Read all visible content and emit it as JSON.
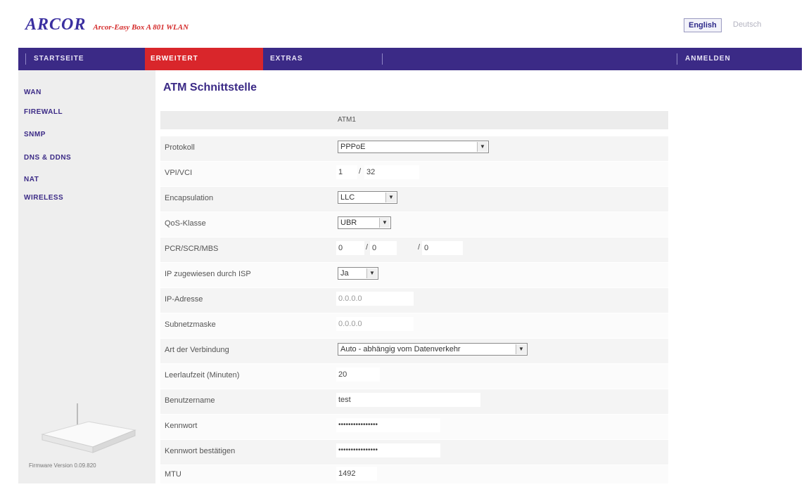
{
  "header": {
    "logo": "ARCOR",
    "logo_tagline": "Arcor-Easy Box A 801 WLAN",
    "lang_english": "English",
    "lang_deutsch": "Deutsch"
  },
  "nav": {
    "items": [
      "STARTSEITE",
      "ERWEITERT",
      "EXTRAS"
    ],
    "active": "ERWEITERT",
    "login": "ANMELDEN"
  },
  "sidebar": {
    "items": [
      "WAN",
      "FIREWALL",
      "SNMP",
      "DNS & DDNS",
      "NAT",
      "WIRELESS"
    ],
    "firmware": "Firmware Version 0.09.820"
  },
  "main": {
    "title": "ATM Schnittstelle",
    "column_header": "ATM1",
    "protokoll": {
      "label": "Protokoll",
      "value": "PPPoE"
    },
    "vpivci": {
      "label": "VPI/VCI",
      "vpi": "1",
      "vci_sep": "/",
      "vci": "32"
    },
    "encapsulation": {
      "label": "Encapsulation",
      "value": "LLC"
    },
    "qos": {
      "label": "QoS-Klasse",
      "value": "UBR"
    },
    "pcr": {
      "label": "PCR/SCR/MBS",
      "pcr": "0",
      "scr": "0",
      "mbs": "0",
      "sep": "/"
    },
    "ip_isp": {
      "label": "IP zugewiesen durch ISP",
      "value": "Ja"
    },
    "ip_address": {
      "label": "IP-Adresse",
      "value": "0.0.0.0"
    },
    "subnet": {
      "label": "Subnetzmaske",
      "value": "0.0.0.0"
    },
    "connection_type": {
      "label": "Art der Verbindung",
      "value": "Auto - abhängig vom Datenverkehr"
    },
    "idle_time": {
      "label": "Leerlaufzeit (Minuten)",
      "value": "20"
    },
    "username": {
      "label": "Benutzername",
      "value": "test"
    },
    "password": {
      "label": "Kennwort",
      "value": "••••••••••••••••"
    },
    "password_confirm": {
      "label": "Kennwort bestätigen",
      "value": "••••••••••••••••"
    },
    "mtu": {
      "label": "MTU",
      "value": "1492"
    }
  },
  "colors": {
    "nav_bg": "#3b2a86",
    "nav_active": "#d9262b",
    "brand_text": "#3a2fa0",
    "sidebar_bg": "#eeeeee"
  }
}
